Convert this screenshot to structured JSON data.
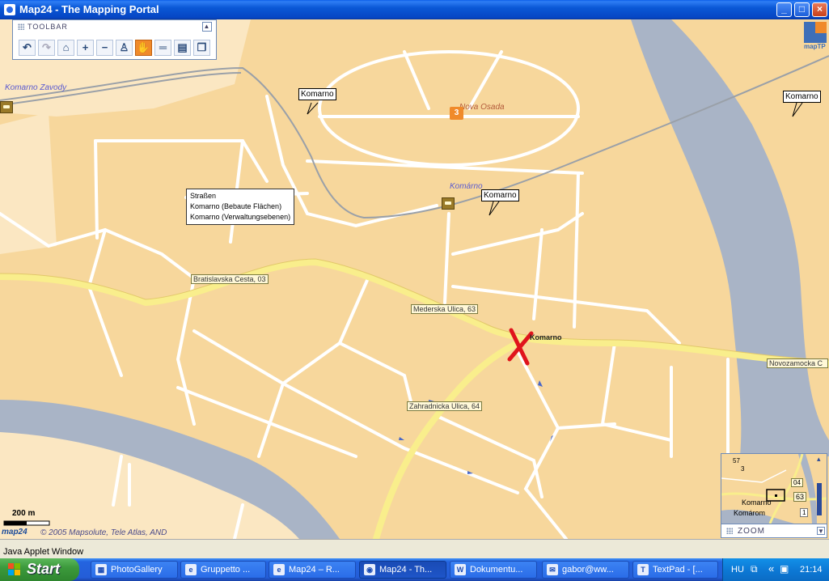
{
  "window": {
    "title": "Map24 - The Mapping Portal"
  },
  "toolbar": {
    "title": "TOOLBAR",
    "buttons": [
      {
        "name": "undo",
        "glyph": "↶"
      },
      {
        "name": "redo",
        "glyph": "↷"
      },
      {
        "name": "lock",
        "glyph": "⌂"
      },
      {
        "name": "zoom-in",
        "glyph": "+"
      },
      {
        "name": "zoom-out",
        "glyph": "−"
      },
      {
        "name": "person",
        "glyph": "♙"
      },
      {
        "name": "pan-hand",
        "glyph": "✋"
      },
      {
        "name": "measure",
        "glyph": "═"
      },
      {
        "name": "print",
        "glyph": "▤"
      },
      {
        "name": "window",
        "glyph": "❐"
      }
    ]
  },
  "map": {
    "places": {
      "komarno_zavody": "Komarno Zavody",
      "nova_osada": "Nova Osada",
      "komarno": "Komárno",
      "komarno_bold": "Komarno"
    },
    "callouts": [
      "Komarno",
      "Komarno",
      "Komarno"
    ],
    "tooltip": [
      "Straßen",
      "Komarno (Bebaute Flächen)",
      "Komarno (Verwaltungsebenen)"
    ],
    "roads": {
      "bratislavska": "Bratislavska Cesta, 03",
      "mederska": "Mederska Ulica, 63",
      "novozamocka": "Novozamocka C",
      "zahradnicka": "Zahradnicka Ulica, 64"
    },
    "route_badge": "3",
    "scale": "200 m",
    "copyright": "© 2005 Mapsolute, Tele Atlas, AND",
    "logo_text": "map24",
    "brand_text": "mapTP"
  },
  "minimap": {
    "labels": [
      "04",
      "63",
      "Komarno",
      "Komárom",
      "57",
      "3",
      "1"
    ]
  },
  "zoom": {
    "title": "ZOOM"
  },
  "status": {
    "text": "Java Applet Window"
  },
  "taskbar": {
    "start": "Start",
    "tasks": [
      "PhotoGallery",
      "Gruppetto ...",
      "Map24 – R...",
      "Map24 - Th...",
      "Dokumentu...",
      "gabor@ww...",
      "TextPad - [..."
    ],
    "lang": "HU",
    "clock": "21:14"
  },
  "colors": {
    "land": "#f7d79c",
    "water": "#a9b4c6",
    "main_road": "#f9ee8c",
    "accent": "#f08a2a"
  }
}
